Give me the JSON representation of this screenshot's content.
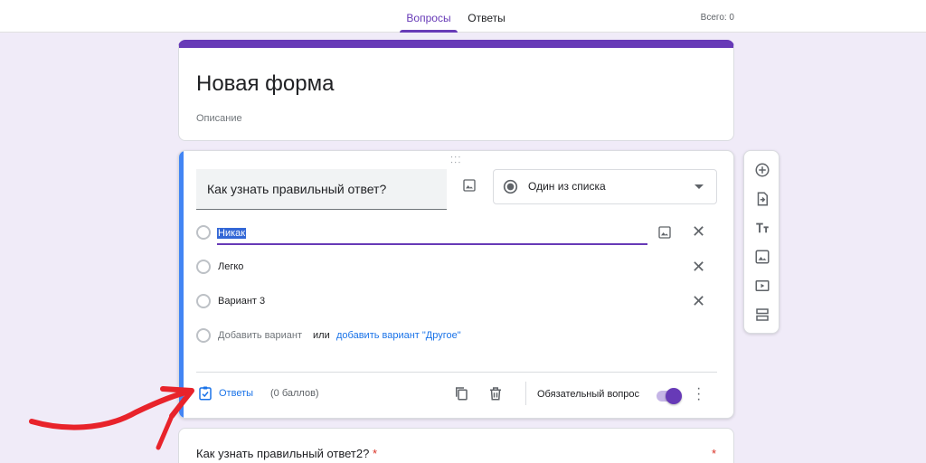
{
  "header": {
    "tabs": [
      {
        "label": "Вопросы",
        "active": true
      },
      {
        "label": "Ответы",
        "active": false
      }
    ],
    "total": "Всего: 0"
  },
  "form": {
    "title": "Новая форма",
    "description_placeholder": "Описание"
  },
  "question": {
    "text": "Как узнать правильный ответ?",
    "type": "Один из списка",
    "options": [
      "Никак",
      "Легко",
      "Вариант 3"
    ],
    "add_option": "Добавить вариант",
    "or": "или",
    "add_other": "добавить вариант \"Другое\"",
    "answers_label": "Ответы",
    "points": "(0 баллов)",
    "required_label": "Обязательный вопрос",
    "required": true
  },
  "question2": {
    "text": "Как узнать правильный ответ2?",
    "required_marker": "*"
  },
  "side_toolbar": [
    "add-question-icon",
    "import-questions-icon",
    "add-title-icon",
    "add-image-icon",
    "add-video-icon",
    "add-section-icon"
  ],
  "colors": {
    "accent": "#673ab7",
    "link": "#1a73e8",
    "background": "#f0ebf8",
    "annotation": "#e8232b"
  }
}
